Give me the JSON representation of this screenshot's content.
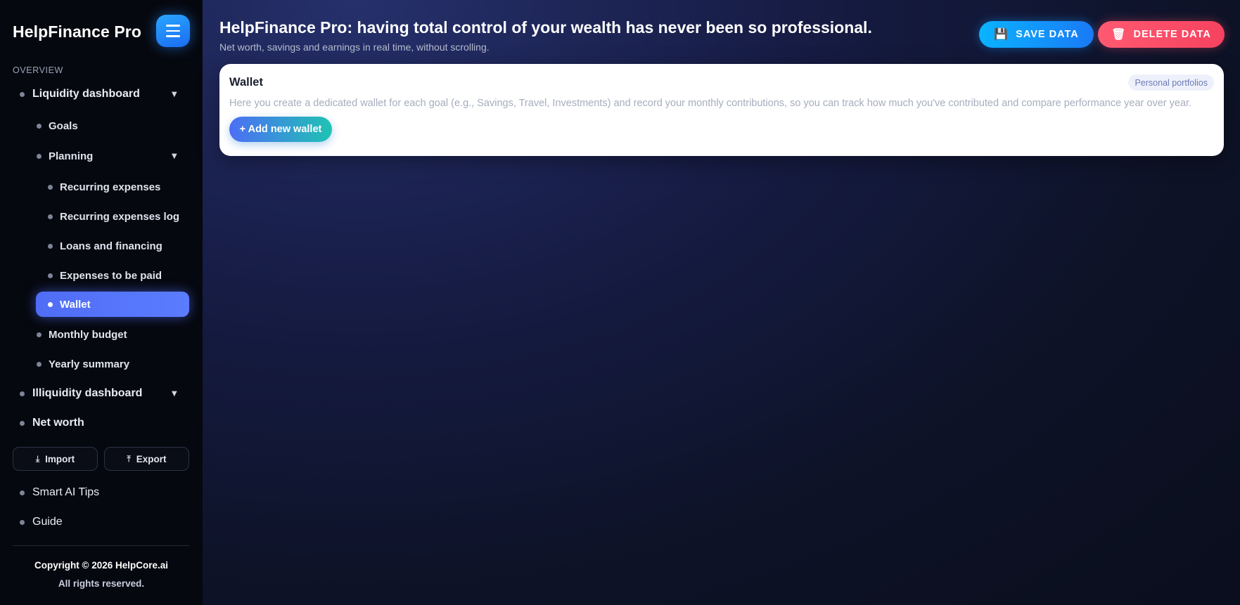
{
  "app": {
    "brand": "HelpFinance Pro"
  },
  "sidebar": {
    "section_label": "OVERVIEW",
    "items": {
      "liquidity": "Liquidity dashboard",
      "goals": "Goals",
      "planning": "Planning",
      "recurring_expenses": "Recurring expenses",
      "recurring_expenses_log": "Recurring expenses log",
      "loans": "Loans and financing",
      "expenses_to_pay": "Expenses to be paid",
      "wallet": "Wallet",
      "monthly_budget": "Monthly budget",
      "yearly_summary": "Yearly summary",
      "illiquidity": "Illiquidity dashboard",
      "net_worth": "Net worth",
      "smart_ai_tips": "Smart AI Tips",
      "guide": "Guide"
    },
    "active_item": "Wallet",
    "import_label": "Import",
    "export_label": "Export",
    "copyright_line1": "Copyright © 2026 HelpCore.ai",
    "copyright_line2": "All rights reserved."
  },
  "header": {
    "title": "HelpFinance Pro: having total control of your wealth has never been so professional.",
    "subtitle": "Net worth, savings and earnings in real time, without scrolling.",
    "save_label": "SAVE DATA",
    "delete_label": "DELETE DATA"
  },
  "wallet_card": {
    "title": "Wallet",
    "badge": "Personal portfolios",
    "description": "Here you create a dedicated wallet for each goal (e.g., Savings, Travel, Investments) and record your monthly contributions, so you can track how much you've contributed and compare performance year over year.",
    "add_button": "+ Add new wallet"
  },
  "icons": {
    "menu": "hamburger-menu-icon",
    "save": "floppy-disk-icon",
    "delete": "trash-icon",
    "import": "download-icon",
    "export": "upload-icon",
    "caret": "chevron-down-icon"
  },
  "colors": {
    "accent": "#5b7cff",
    "save": "#0ab3ff",
    "delete": "#f6425f",
    "sidebar_bg": "#06080f"
  }
}
